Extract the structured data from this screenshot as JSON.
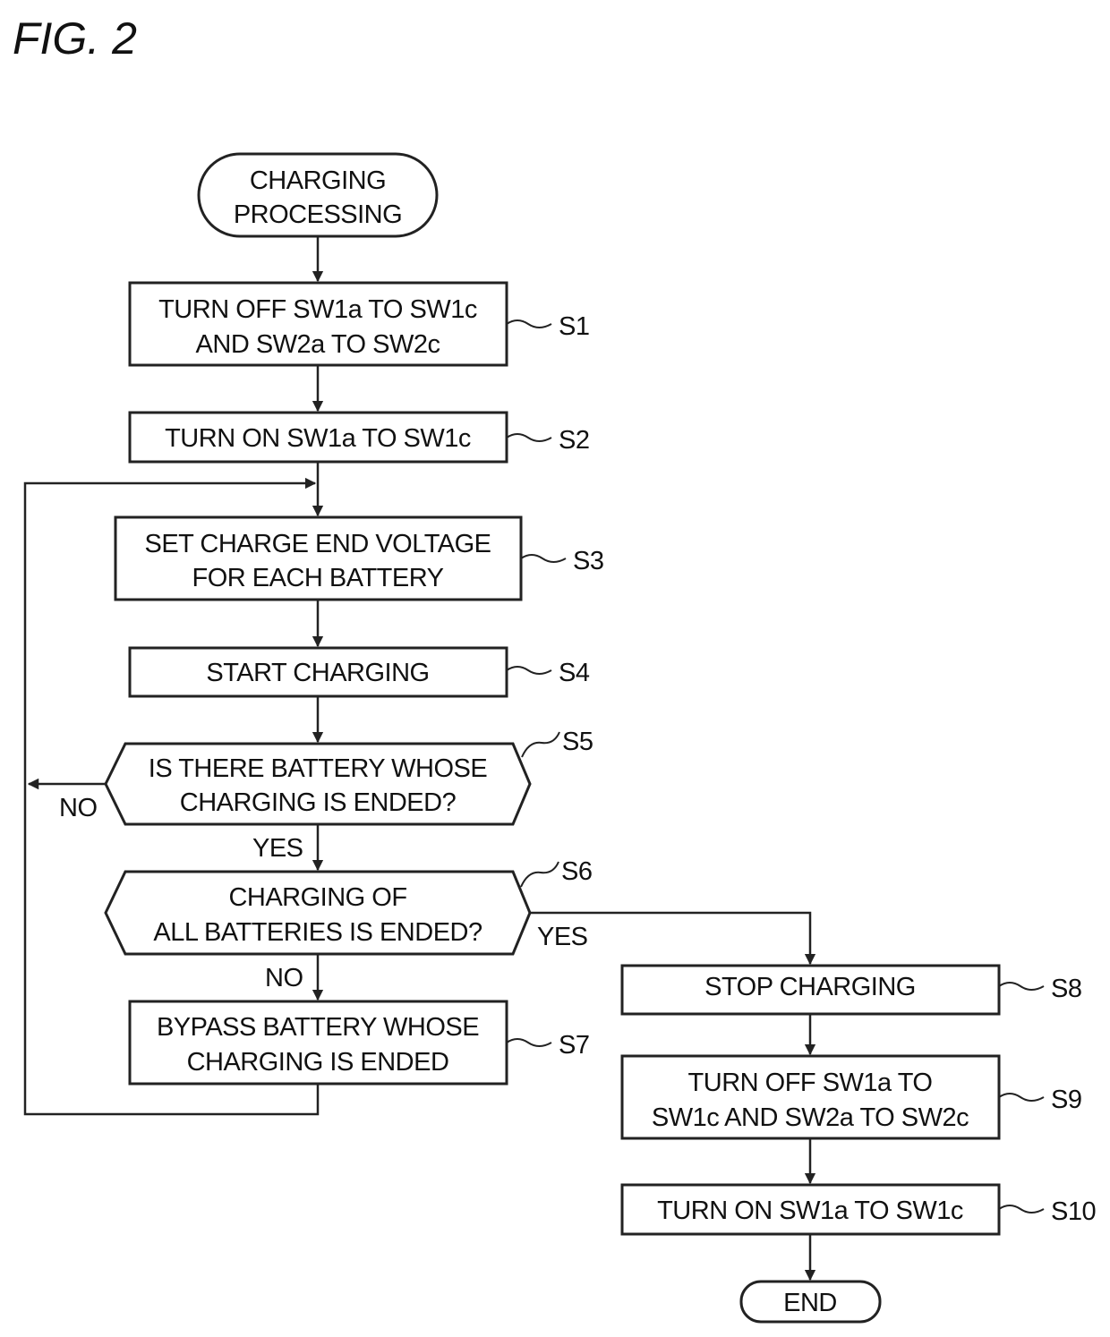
{
  "figure": {
    "title": "FIG. 2"
  },
  "flowchart": {
    "start": {
      "lines": [
        "CHARGING",
        "PROCESSING"
      ]
    },
    "steps": {
      "s1": {
        "label": "S1",
        "lines": [
          "TURN OFF SW1a TO SW1c",
          "AND SW2a TO SW2c"
        ]
      },
      "s2": {
        "label": "S2",
        "lines": [
          "TURN ON SW1a TO SW1c"
        ]
      },
      "s3": {
        "label": "S3",
        "lines": [
          "SET CHARGE END VOLTAGE",
          "FOR EACH BATTERY"
        ]
      },
      "s4": {
        "label": "S4",
        "lines": [
          "START CHARGING"
        ]
      },
      "s5": {
        "label": "S5",
        "lines": [
          "IS THERE BATTERY WHOSE",
          "CHARGING IS ENDED?"
        ],
        "yes": "YES",
        "no": "NO"
      },
      "s6": {
        "label": "S6",
        "lines": [
          "CHARGING OF",
          "ALL BATTERIES IS ENDED?"
        ],
        "yes": "YES",
        "no": "NO"
      },
      "s7": {
        "label": "S7",
        "lines": [
          "BYPASS BATTERY WHOSE",
          "CHARGING IS ENDED"
        ]
      },
      "s8": {
        "label": "S8",
        "lines": [
          "STOP CHARGING"
        ]
      },
      "s9": {
        "label": "S9",
        "lines": [
          "TURN OFF SW1a TO",
          "SW1c AND SW2a TO SW2c"
        ]
      },
      "s10": {
        "label": "S10",
        "lines": [
          "TURN ON SW1a TO SW1c"
        ]
      }
    },
    "end": {
      "lines": [
        "END"
      ]
    }
  }
}
